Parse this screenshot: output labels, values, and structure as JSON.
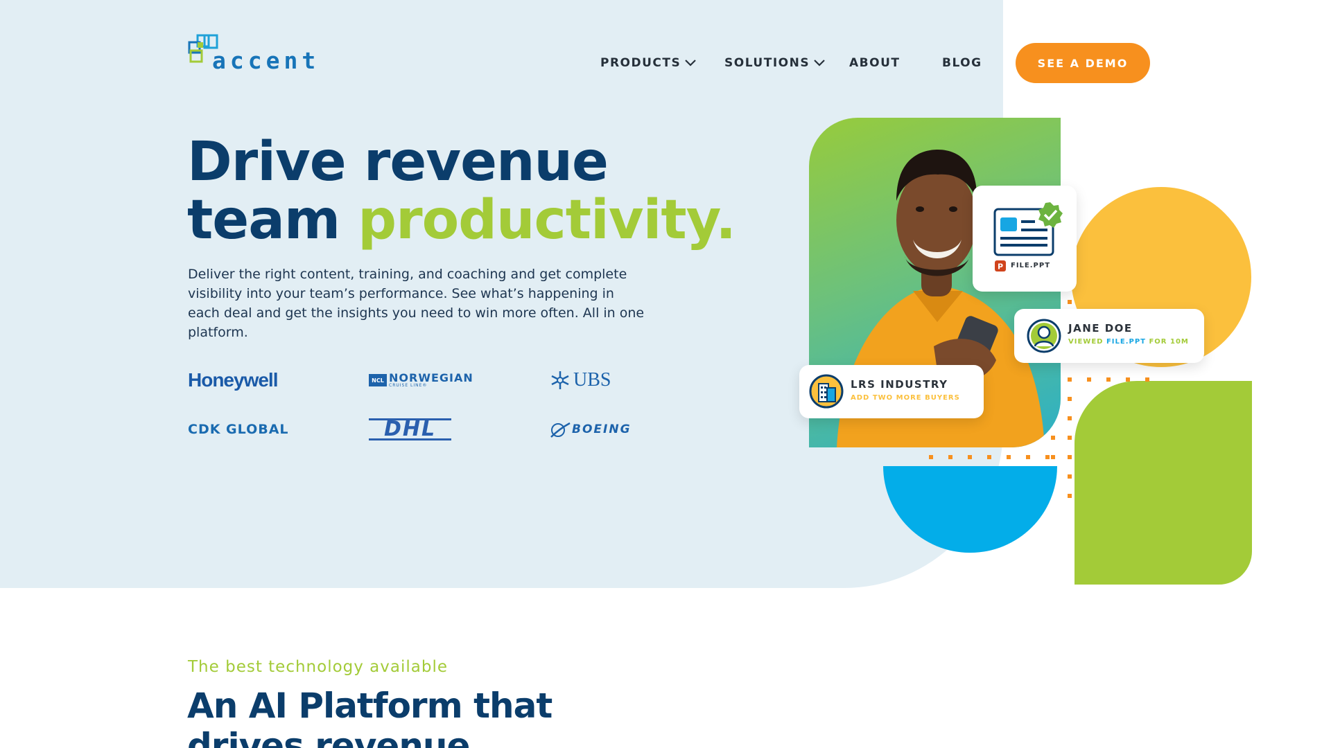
{
  "brand": {
    "name": "accent"
  },
  "nav": {
    "products": "PRODUCTS",
    "solutions": "SOLUTIONS",
    "about": "ABOUT",
    "blog": "BLOG",
    "cta": "SEE A DEMO"
  },
  "hero": {
    "headline_line1": "Drive revenue",
    "headline_line2_prefix": "team ",
    "headline_line2_highlight": "productivity.",
    "subtext": "Deliver the right content, training, and coaching and get complete visibility into your team’s performance. See what’s happening in each deal and get the insights you need to win more often. All in one platform."
  },
  "customer_logos": {
    "honeywell": "Honeywell",
    "ncl_badge": "NCL",
    "ncl_main": "NORWEGIAN",
    "ncl_sub": "CRUISE LINE®",
    "ubs": "UBS",
    "cdk": "CDK GLOBAL",
    "dhl": "DHL",
    "boeing": "BOEING"
  },
  "cards": {
    "file_label": "FILE.PPT",
    "jane_name": "JANE DOE",
    "jane_viewed": "VIEWED ",
    "jane_file": "FILE.PPT",
    "jane_duration": " FOR 10M",
    "lrs_name": "LRS INDUSTRY",
    "lrs_action": "ADD TWO MORE BUYERS"
  },
  "section2": {
    "eyebrow": "The best technology available",
    "title": "An AI Platform that drives revenue"
  },
  "colors": {
    "navy": "#0b3d6b",
    "green": "#a3cb38",
    "orange": "#f7901e",
    "yellow": "#fbc03d",
    "blue": "#03ade9",
    "hero_bg": "#e2eef4"
  },
  "icons": [
    "chevron-down-icon",
    "document-icon",
    "check-badge-icon",
    "powerpoint-icon",
    "user-avatar-icon",
    "building-icon"
  ]
}
